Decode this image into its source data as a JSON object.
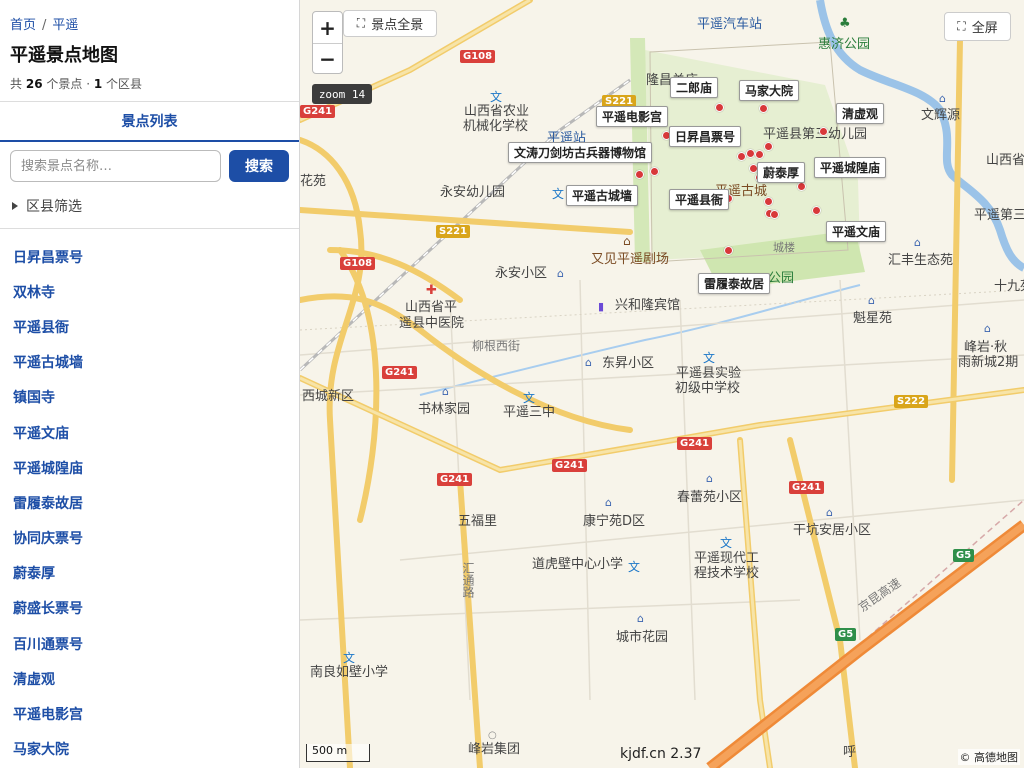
{
  "breadcrumb": {
    "home": "首页",
    "current": "平遥"
  },
  "page_title": "平遥景点地图",
  "meta": {
    "prefix": "共",
    "spots": "26",
    "spots_suffix": "个景点 ·",
    "areas": "1",
    "areas_suffix": "个区县"
  },
  "tab_label": "景点列表",
  "search": {
    "placeholder": "搜索景点名称…",
    "button": "搜索"
  },
  "filter_label": "区县筛选",
  "list": [
    "日昇昌票号",
    "双林寺",
    "平遥县衙",
    "平遥古城墙",
    "镇国寺",
    "平遥文庙",
    "平遥城隍庙",
    "雷履泰故居",
    "协同庆票号",
    "蔚泰厚",
    "蔚盛长票号",
    "百川通票号",
    "清虚观",
    "平遥电影宫",
    "马家大院"
  ],
  "map": {
    "overview_button": "景点全景",
    "fullscreen_button": "全屏",
    "zoom_in": "+",
    "zoom_out": "−",
    "zoom_level": "zoom 14",
    "scale": "500 m",
    "attribution": "© 高德地图",
    "watermark": "kjdf.cn 2.37",
    "place_labels": [
      "平遥电影宫",
      "二郎庙",
      "马家大院",
      "清虚观",
      "日昇昌票号",
      "文涛刀剑坊古兵器博物馆",
      "蔚泰厚",
      "平遥城隍庙",
      "平遥古城墙",
      "平遥县衙",
      "平遥文庙",
      "雷履泰故居"
    ],
    "texts": {
      "bus_station": "平遥汽车站",
      "huiji_park": "惠济公园",
      "longyi": "隆昌关庙",
      "agri_school": "山西省农业",
      "agri_school2": "机械化学校",
      "pingyao_station": "平遥站",
      "kindergarten3": "平遥县第三幼儿园",
      "wenhuiyuan": "文辉源",
      "shanxi_right": "山西省",
      "pingyao_no3": "平遥第三",
      "yongan_kg": "永安幼儿园",
      "ancient_city": "平遥古城",
      "youjian": "又见平遥剧场",
      "chenglou": "城楼",
      "park": "公园",
      "huifeng": "汇丰生态苑",
      "shiyuan": "十九苑",
      "yongan_district": "永安小区",
      "xinghelong": "兴和隆宾馆",
      "hospital1": "山西省平",
      "hospital2": "遥县中医院",
      "liugen": "柳根西街",
      "kuixing": "魁星苑",
      "fengyan1": "峰岩·秋",
      "fengyan2": "雨新城2期",
      "dongsheng": "东昇小区",
      "exp1": "平遥县实验",
      "exp2": "初级中学校",
      "xicheng": "西城新区",
      "shulin": "书林家园",
      "pyz3": "平遥三中",
      "chunlei": "春蕾苑小区",
      "wufuli": "五福里",
      "kangning": "康宁苑D区",
      "qiankeng": "干坑安居小区",
      "daohubi": "道虎壁中心小学",
      "modern1": "平遥现代工",
      "modern2": "程技术学校",
      "huitong": "汇通路",
      "chengshi": "城市花园",
      "nanliang": "南良如壁小学",
      "fengyan_group": "峰岩集团",
      "jingkun": "京昆高速",
      "huahua": "花苑",
      "hu": "呼"
    },
    "shields": {
      "g108a": "G108",
      "g108b": "G108",
      "g241a": "G241",
      "g241b": "G241",
      "g241c": "G241",
      "g241d": "G241",
      "g241e": "G241",
      "g241f": "G241",
      "s221a": "S221",
      "s221b": "S221",
      "s222": "S222",
      "g5a": "G5",
      "g5b": "G5"
    }
  }
}
